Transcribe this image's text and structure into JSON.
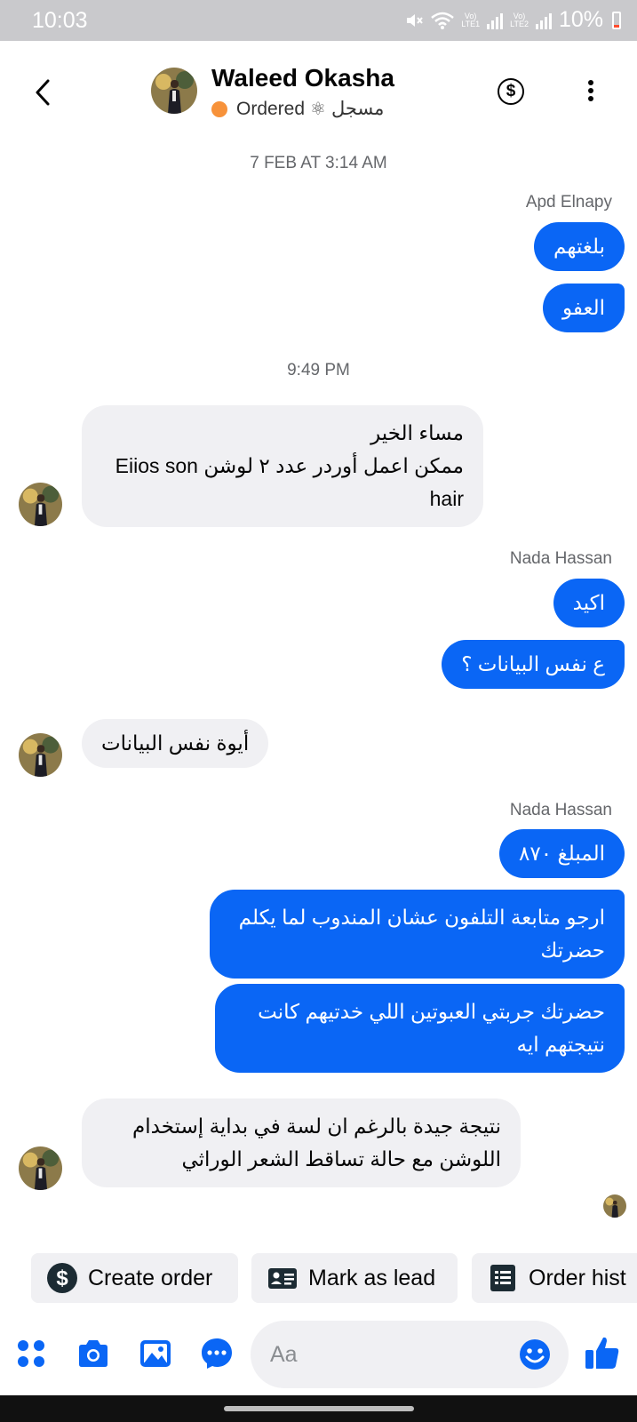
{
  "status_bar": {
    "time": "10:03",
    "sim1": "LTE1",
    "sim2": "LTE2",
    "battery": "10%"
  },
  "header": {
    "contact_name": "Waleed Okasha",
    "status_label": "Ordered",
    "tag_label": "مسجل"
  },
  "messages": {
    "timestamp_1": "7 FEB AT 3:14 AM",
    "sender_1": "Apd Elnapy",
    "out_1": "بلغتهم",
    "out_2": "العفو",
    "timestamp_2": "9:49 PM",
    "in_1_line1": "مساء الخير",
    "in_1_line2": "ممكن اعمل أوردر عدد ٢ لوشن Eiios son",
    "in_1_line3": "hair",
    "sender_2": "Nada Hassan",
    "out_3": "اكيد",
    "out_4": "ع نفس البيانات ؟",
    "in_2": "أيوة نفس البيانات",
    "sender_3": "Nada Hassan",
    "out_5": "المبلغ ٨٧٠",
    "out_6_line1": "ارجو متابعة التلفون عشان المندوب لما يكلم",
    "out_6_line2": "حضرتك",
    "out_7_line1": "حضرتك جربتي العبوتين اللي خدتيهم كانت",
    "out_7_line2": "نتيجتهم ايه",
    "in_3_line1": "نتيجة جيدة بالرغم ان لسة في بداية إستخدام",
    "in_3_line2": "اللوشن مع حالة تساقط الشعر الوراثي"
  },
  "quick_actions": {
    "create_order": "Create order",
    "mark_as_lead": "Mark as lead",
    "order_history": "Order hist"
  },
  "composer": {
    "placeholder": "Aa"
  },
  "colors": {
    "outgoing_bubble": "#0a66f5",
    "incoming_bubble": "#f0f0f3",
    "accent_icon": "#0a66f5",
    "status_dot": "#f7923a"
  }
}
